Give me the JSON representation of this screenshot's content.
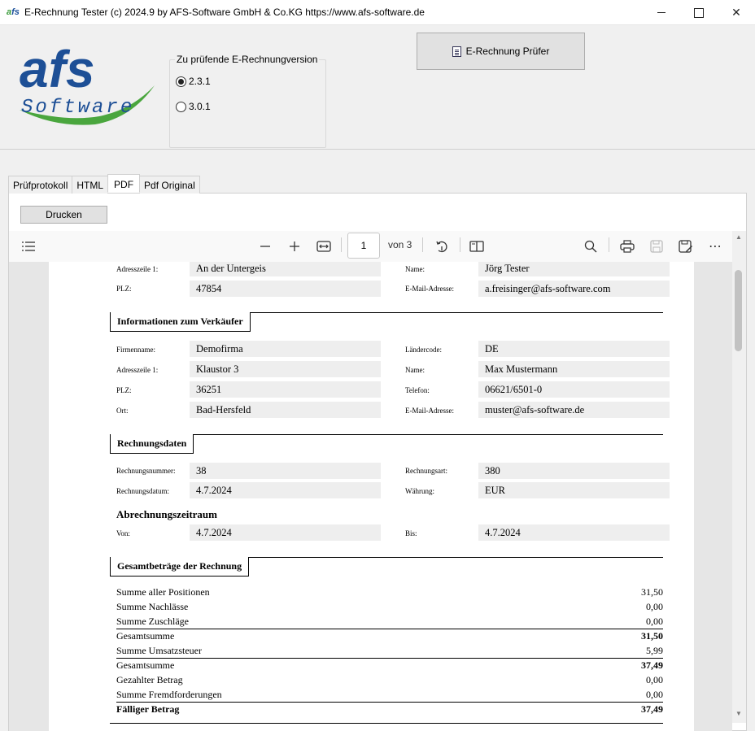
{
  "window": {
    "title": "E-Rechnung Tester (c) 2024.9 by AFS-Software GmbH & Co.KG  https://www.afs-software.de",
    "icon_text": "afs"
  },
  "logo": {
    "main": "afs",
    "sub": "Software"
  },
  "version_group": {
    "title": "Zu prüfende E-Rechnungversion",
    "options": [
      {
        "label": "2.3.1",
        "selected": true
      },
      {
        "label": "3.0.1",
        "selected": false
      }
    ]
  },
  "pruefer_button": "E-Rechnung Prüfer",
  "tabs": [
    {
      "label": "Prüfprotokoll",
      "active": false
    },
    {
      "label": "HTML",
      "active": false
    },
    {
      "label": "PDF",
      "active": true
    },
    {
      "label": "Pdf Original",
      "active": false
    }
  ],
  "drucken_button": "Drucken",
  "pdf_toolbar": {
    "page": "1",
    "of_pages": "von 3"
  },
  "pdf": {
    "buyer_rows": [
      {
        "l1": "Adresszeile 1:",
        "v1": "An der Untergeis",
        "l2": "Name:",
        "v2": "Jörg Tester"
      },
      {
        "l1": "PLZ:",
        "v1": "47854",
        "l2": "E-Mail-Adresse:",
        "v2": "a.freisinger@afs-software.com"
      }
    ],
    "seller": {
      "heading": "Informationen zum Verkäufer",
      "rows": [
        {
          "l1": "Firmenname:",
          "v1": "Demofirma",
          "l2": "Ländercode:",
          "v2": "DE"
        },
        {
          "l1": "Adresszeile 1:",
          "v1": "Klaustor 3",
          "l2": "Name:",
          "v2": "Max Mustermann"
        },
        {
          "l1": "PLZ:",
          "v1": "36251",
          "l2": "Telefon:",
          "v2": "06621/6501-0"
        },
        {
          "l1": "Ort:",
          "v1": "Bad-Hersfeld",
          "l2": "E-Mail-Adresse:",
          "v2": "muster@afs-software.de"
        }
      ]
    },
    "invoice": {
      "heading": "Rechnungsdaten",
      "rows": [
        {
          "l1": "Rechnungsnummer:",
          "v1": "38",
          "l2": "Rechnungsart:",
          "v2": "380"
        },
        {
          "l1": "Rechnungsdatum:",
          "v1": "4.7.2024",
          "l2": "Währung:",
          "v2": "EUR"
        }
      ],
      "period_title": "Abrechnungszeitraum",
      "period": {
        "l1": "Von:",
        "v1": "4.7.2024",
        "l2": "Bis:",
        "v2": "4.7.2024"
      }
    },
    "totals": {
      "heading": "Gesamtbeträge der Rechnung",
      "rows": [
        {
          "label": "Summe aller Positionen",
          "value": "31,50",
          "bold": false
        },
        {
          "label": "Summe Nachlässe",
          "value": "0,00",
          "bold": false
        },
        {
          "label": "Summe Zuschläge",
          "value": "0,00",
          "bold": false
        },
        {
          "label": "Gesamtsumme",
          "value": "31,50",
          "bold": false,
          "bold_value": true
        },
        {
          "label": "Summe Umsatzsteuer",
          "value": "5,99",
          "bold": false
        },
        {
          "label": "Gesamtsumme",
          "value": "37,49",
          "bold": false,
          "bold_value": true
        },
        {
          "label": "Gezahlter Betrag",
          "value": "0,00",
          "bold": false
        },
        {
          "label": "Summe Fremdforderungen",
          "value": "0,00",
          "bold": false
        },
        {
          "label": "Fälliger Betrag",
          "value": "37,49",
          "bold": true
        }
      ]
    }
  }
}
